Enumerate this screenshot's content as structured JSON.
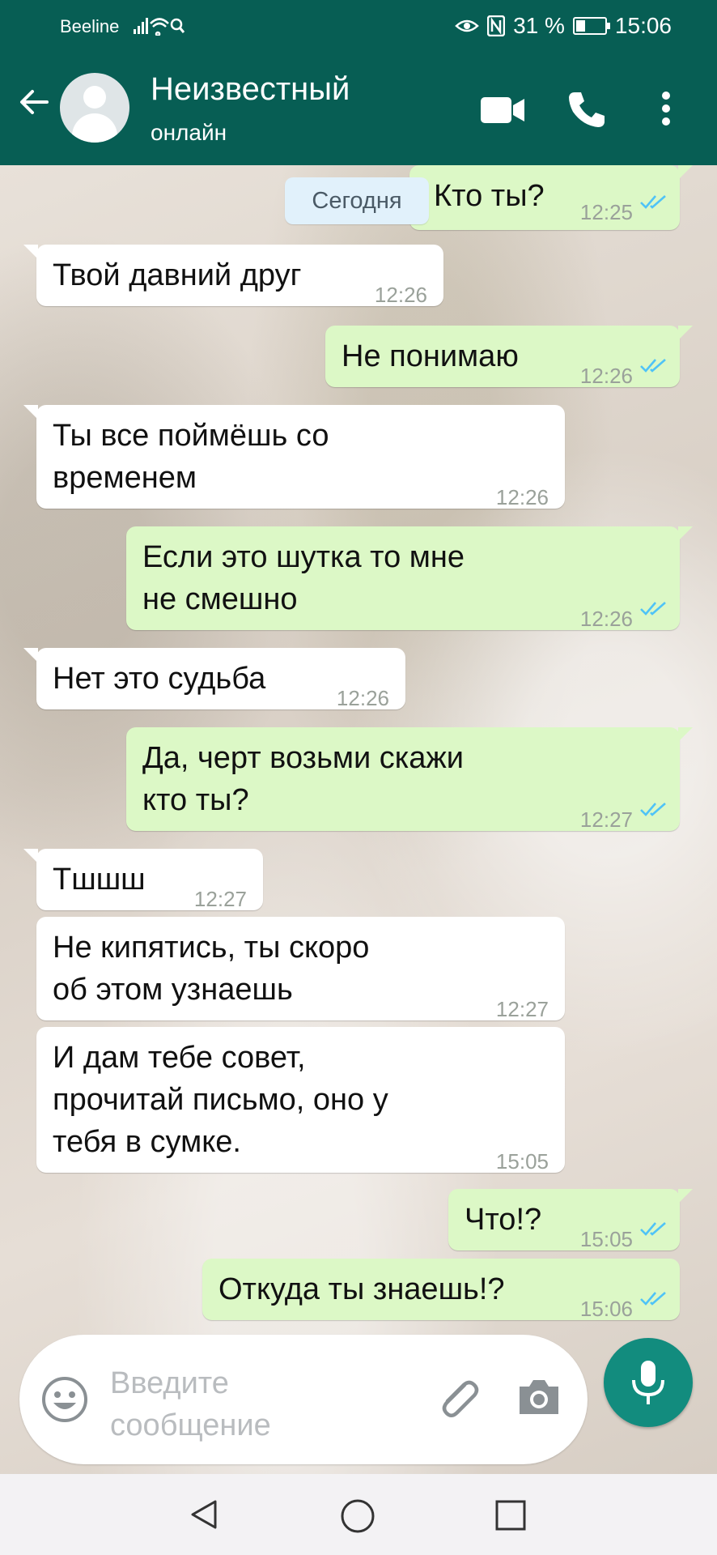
{
  "status_bar": {
    "carrier": "Beeline",
    "signal": "·ıl",
    "battery_text": "31 %",
    "battery_level": 0.31,
    "time": "15:06"
  },
  "header": {
    "contact_name": "Неизвестный",
    "contact_status": "онлайн",
    "icons": [
      "back-arrow-icon",
      "avatar",
      "video-call-icon",
      "phone-icon",
      "more-menu-icon"
    ]
  },
  "chat": {
    "date_chip": "Сегодня",
    "messages": [
      {
        "side": "out",
        "text": "Кто ты?",
        "time": "12:25",
        "read": true
      },
      {
        "side": "in",
        "text": "Твой давний друг",
        "time": "12:26"
      },
      {
        "side": "out",
        "text": "Не понимаю",
        "time": "12:26",
        "read": true
      },
      {
        "side": "in",
        "lines": [
          "Ты все поймёшь со",
          "временем"
        ],
        "time": "12:26"
      },
      {
        "side": "out",
        "lines": [
          "Если это шутка то мне",
          "не смешно"
        ],
        "time": "12:26",
        "read": true
      },
      {
        "side": "in",
        "text": "Нет это судьба",
        "time": "12:26"
      },
      {
        "side": "out",
        "lines": [
          "Да, черт возьми скажи",
          "кто ты?"
        ],
        "time": "12:27",
        "read": true
      },
      {
        "side": "in",
        "text": "Тшшш",
        "time": "12:27"
      },
      {
        "side": "in",
        "lines": [
          "Не кипятись, ты скоро",
          "об этом узнаешь"
        ],
        "time": "12:27"
      },
      {
        "side": "in",
        "lines": [
          "И дам тебе совет,",
          "прочитай письмо, оно у",
          "тебя в сумке."
        ],
        "time": "15:05"
      },
      {
        "side": "out",
        "text": "Что!?",
        "time": "15:05",
        "read": true
      },
      {
        "side": "out",
        "text": "Откуда ты знаешь!?",
        "time": "15:06",
        "read": true
      }
    ]
  },
  "input": {
    "placeholder_lines": [
      "Введите",
      "сообщение"
    ],
    "icons": [
      "emoji-icon",
      "attach-icon",
      "camera-icon",
      "mic-icon"
    ]
  },
  "colors": {
    "header_bg": "#075e54",
    "outgoing_bubble": "#dcf8c6",
    "incoming_bubble": "#ffffff",
    "read_ticks": "#4fc3f7",
    "mic_button": "#128c7e"
  }
}
